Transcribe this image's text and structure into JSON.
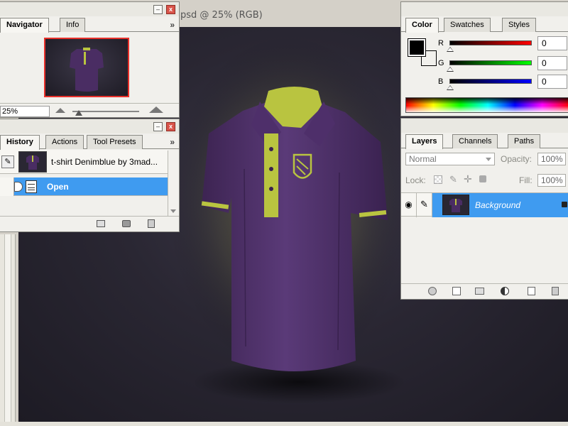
{
  "document": {
    "title": "psd @ 25% (RGB)"
  },
  "navigator": {
    "tabs": [
      {
        "label": "Navigator",
        "active": true
      },
      {
        "label": "Info",
        "active": false
      }
    ],
    "zoom_value": "25%"
  },
  "history": {
    "tabs": [
      {
        "label": "History",
        "active": true
      },
      {
        "label": "Actions",
        "active": false
      },
      {
        "label": "Tool Presets",
        "active": false
      }
    ],
    "snapshot_label": "t-shirt Denimblue by 3mad...",
    "states": [
      {
        "label": "Open",
        "selected": true
      }
    ]
  },
  "color": {
    "tabs": [
      {
        "label": "Color",
        "active": true
      },
      {
        "label": "Swatches",
        "active": false
      },
      {
        "label": "Styles",
        "active": false
      }
    ],
    "sliders": [
      {
        "channel": "R",
        "value": "0",
        "gradient": "#ff0000"
      },
      {
        "channel": "G",
        "value": "0",
        "gradient": "#00ff00"
      },
      {
        "channel": "B",
        "value": "0",
        "gradient": "#0000ff"
      }
    ],
    "foreground": "#000000",
    "background": "#ffffff"
  },
  "layers": {
    "tabs": [
      {
        "label": "Layers",
        "active": true
      },
      {
        "label": "Channels",
        "active": false
      },
      {
        "label": "Paths",
        "active": false
      }
    ],
    "blend_mode": "Normal",
    "opacity_label": "Opacity:",
    "opacity_value": "100%",
    "lock_label": "Lock:",
    "fill_label": "Fill:",
    "fill_value": "100%",
    "layer_name": "Background"
  },
  "palette_menu_glyph": "»",
  "window_buttons": {
    "minimize": "–",
    "close": "x"
  },
  "colors": {
    "selection": "#3f9bf0",
    "shirt": "#4a2d63",
    "collar_accent": "#b9c440",
    "canvas": "#26232e"
  }
}
